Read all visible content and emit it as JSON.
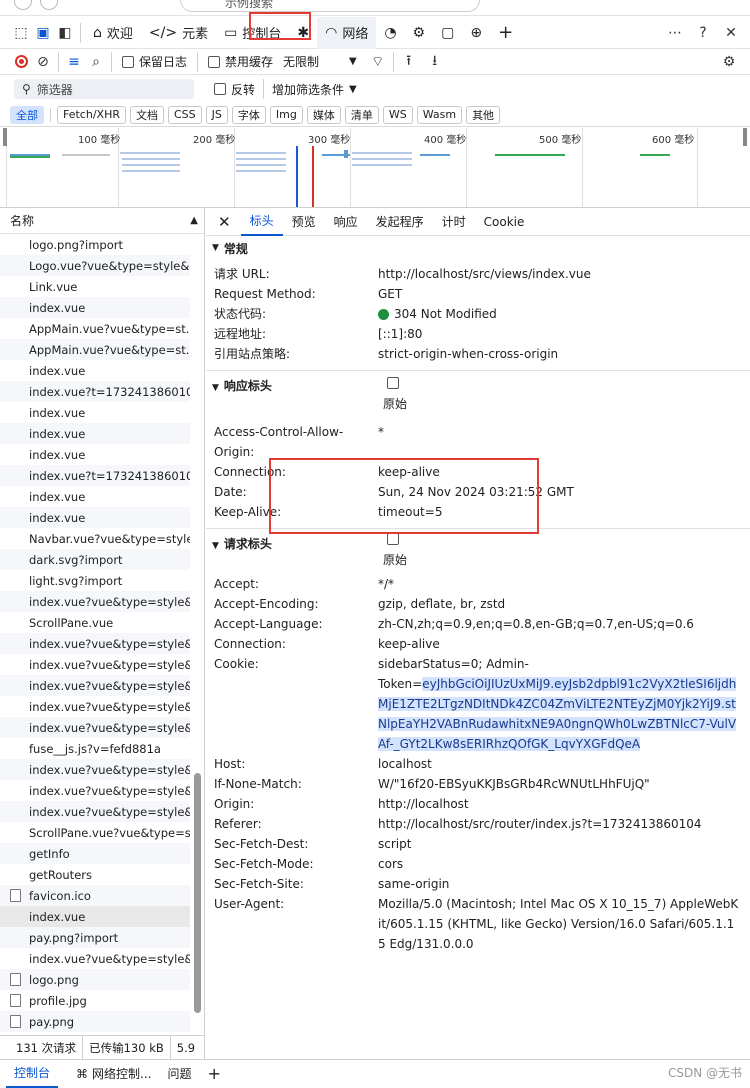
{
  "browser": {
    "address_partial": "示例搜索"
  },
  "tabs": [
    {
      "label": "欢迎",
      "icon": "home-icon"
    },
    {
      "label": "元素",
      "icon": "code-icon"
    },
    {
      "label": "控制台",
      "icon": "console-icon"
    },
    {
      "label": "",
      "icon": "bug-icon"
    },
    {
      "label": "网络",
      "icon": "wifi-icon"
    },
    {
      "label": "",
      "icon": "performance-icon"
    },
    {
      "label": "",
      "icon": "cpu-icon"
    },
    {
      "label": "",
      "icon": "application-icon"
    },
    {
      "label": "",
      "icon": "globe-icon"
    }
  ],
  "toolbar2": {
    "preserve_log": "保留日志",
    "disable_cache": "禁用缓存",
    "throttle": "无限制"
  },
  "filter": {
    "placeholder": "筛选器",
    "invert": "反转",
    "more_filters": "增加筛选条件"
  },
  "type_filters": [
    "全部",
    "Fetch/XHR",
    "文档",
    "CSS",
    "JS",
    "字体",
    "Img",
    "媒体",
    "清单",
    "WS",
    "Wasm",
    "其他"
  ],
  "timeline_ticks": [
    "100 毫秒",
    "200 毫秒",
    "300 毫秒",
    "400 毫秒",
    "500 毫秒",
    "600 毫秒"
  ],
  "request_list": {
    "header": "名称",
    "rows": [
      "logo.png?import",
      "Logo.vue?vue&type=style&...",
      "Link.vue",
      "index.vue",
      "AppMain.vue?vue&type=st...",
      "AppMain.vue?vue&type=st...",
      "index.vue",
      "index.vue?t=1732413860104",
      "index.vue",
      "index.vue",
      "index.vue",
      "index.vue?t=1732413860104",
      "index.vue",
      "index.vue",
      "Navbar.vue?vue&type=style...",
      "dark.svg?import",
      "light.svg?import",
      "index.vue?vue&type=style&...",
      "ScrollPane.vue",
      "index.vue?vue&type=style&...",
      "index.vue?vue&type=style&...",
      "index.vue?vue&type=style&...",
      "index.vue?vue&type=style&...",
      "index.vue?vue&type=style&...",
      "fuse__js.js?v=fefd881a",
      "index.vue?vue&type=style&...",
      "index.vue?vue&type=style&...",
      "index.vue?vue&type=style&...",
      "ScrollPane.vue?vue&type=s...",
      "getInfo",
      "getRouters",
      "favicon.ico",
      "index.vue",
      "pay.png?import",
      "index.vue?vue&type=style&...",
      "logo.png",
      "profile.jpg",
      "pay.png"
    ]
  },
  "status_bar": {
    "requests": "131 次请求",
    "transferred": "已传输130 kB",
    "extra": "5.9"
  },
  "detail_tabs": [
    "标头",
    "预览",
    "响应",
    "发起程序",
    "计时",
    "Cookie"
  ],
  "general": {
    "title": "常规",
    "rows": [
      {
        "k": "请求 URL:",
        "v": "http://localhost/src/views/index.vue"
      },
      {
        "k": "Request Method:",
        "v": "GET"
      },
      {
        "k": "状态代码:",
        "v": "304 Not Modified"
      },
      {
        "k": "远程地址:",
        "v": "[::1]:80"
      },
      {
        "k": "引用站点策略:",
        "v": "strict-origin-when-cross-origin"
      }
    ]
  },
  "response_headers": {
    "title": "响应标头",
    "raw_label": "原始",
    "rows": [
      {
        "k": "Access-Control-Allow-Origin:",
        "v": "*"
      },
      {
        "k": "Connection:",
        "v": "keep-alive"
      },
      {
        "k": "Date:",
        "v": "Sun, 24 Nov 2024 03:21:52 GMT"
      },
      {
        "k": "Keep-Alive:",
        "v": "timeout=5"
      }
    ]
  },
  "request_headers": {
    "title": "请求标头",
    "raw_label": "原始",
    "rows": [
      {
        "k": "Accept:",
        "v": "*/*"
      },
      {
        "k": "Accept-Encoding:",
        "v": "gzip, deflate, br, zstd"
      },
      {
        "k": "Accept-Language:",
        "v": "zh-CN,zh;q=0.9,en;q=0.8,en-GB;q=0.7,en-US;q=0.6"
      },
      {
        "k": "Connection:",
        "v": "keep-alive"
      }
    ],
    "cookie_key": "Cookie:",
    "cookie_prefix": "sidebarStatus=0; Admin-",
    "cookie_token_label": "Token=",
    "cookie_token": "eyJhbGciOiJIUzUxMiJ9.eyJsb2dpbl91c2VyX2tleSI6ljdhMjE1ZTE2LTgzNDItNDk4ZC04ZmViLTE2NTEyZjM0Yjk2YiJ9.stNlpEaYH2VABnRudawhitxNE9A0ngnQWh0LwZBTNlcC7-VulVAf-_GYt2LKw8sERIRhzQOfGK_LqvYXGFdQeA",
    "rows2": [
      {
        "k": "Host:",
        "v": "localhost"
      },
      {
        "k": "If-None-Match:",
        "v": "W/\"16f20-EBSyuKKJBsGRb4RcWNUtLHhFUjQ\""
      },
      {
        "k": "Origin:",
        "v": "http://localhost"
      },
      {
        "k": "Referer:",
        "v": "http://localhost/src/router/index.js?t=1732413860104"
      },
      {
        "k": "Sec-Fetch-Dest:",
        "v": "script"
      },
      {
        "k": "Sec-Fetch-Mode:",
        "v": "cors"
      },
      {
        "k": "Sec-Fetch-Site:",
        "v": "same-origin"
      },
      {
        "k": "User-Agent:",
        "v": "Mozilla/5.0 (Macintosh; Intel Mac OS X 10_15_7) AppleWebKit/605.1.15 (KHTML, like Gecko) Version/16.0 Safari/605.1.15 Edg/131.0.0.0"
      }
    ]
  },
  "bottom_tabs": [
    "控制台",
    "网络控制...",
    "问题"
  ],
  "watermark": "CSDN @无书",
  "colors": {
    "accent": "#0b57d0",
    "highlight": "#d3e3fd",
    "annotation": "#e53935",
    "status_ok": "#1e8e3e"
  }
}
